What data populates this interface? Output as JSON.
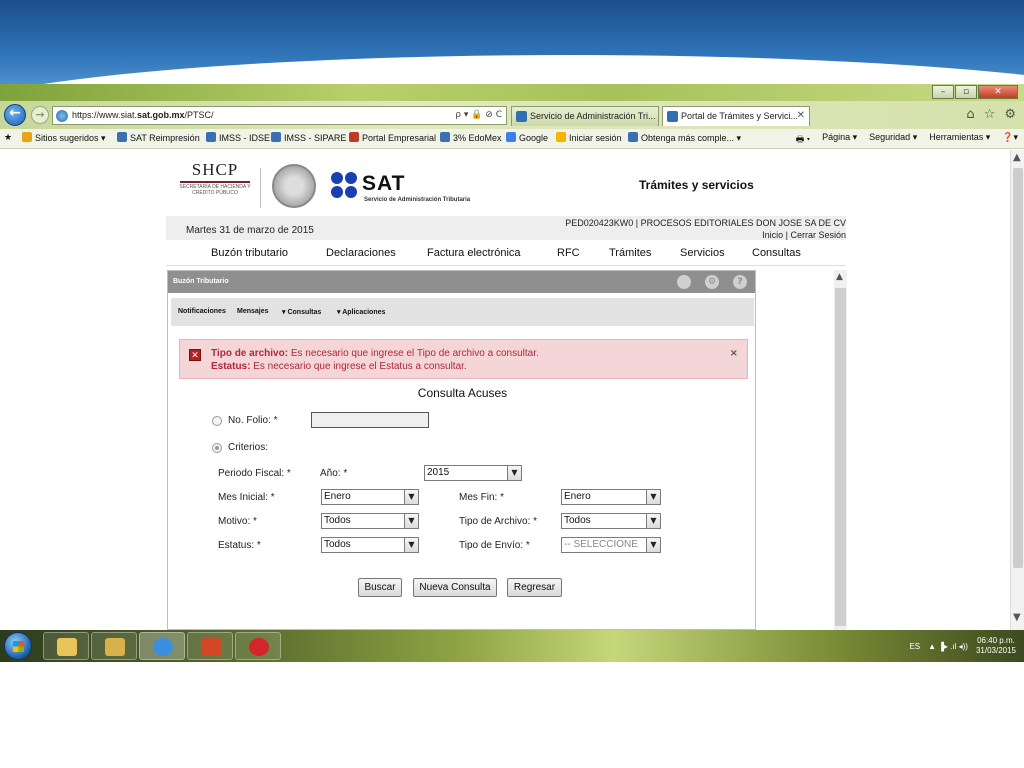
{
  "browser": {
    "url_prefix": "https://www.siat.",
    "url_bold": "sat.gob.mx",
    "url_suffix": "/PTSC/",
    "url_controls": "ρ ▾ 🔒 ⊘ C",
    "tabs": [
      {
        "label": "Servicio de Administración Tri..."
      },
      {
        "label": "Portal de Trámites y Servici...",
        "close": "✕"
      }
    ],
    "favorites": [
      {
        "label": "Sitios sugeridos ▾",
        "color": "#e8a317"
      },
      {
        "label": "SAT Reimpresión",
        "color": "#3a6fb0"
      },
      {
        "label": "IMSS - IDSE",
        "color": "#3a6fb0"
      },
      {
        "label": "IMSS - SIPARE",
        "color": "#3a6fb0"
      },
      {
        "label": "Portal Empresarial",
        "color": "#c0392b"
      },
      {
        "label": "3% EdoMex",
        "color": "#3a6fb0"
      },
      {
        "label": "Google",
        "color": "#3f7ee8"
      },
      {
        "label": "Iniciar sesión",
        "color": "#f4b400"
      },
      {
        "label": "Obtenga más comple... ▾",
        "color": "#3a6fb0"
      }
    ],
    "favorites_right": [
      "Página ▾",
      "Seguridad ▾",
      "Herramientas ▾",
      "❓▾"
    ]
  },
  "header": {
    "shcp_big": "SHCP",
    "shcp_small": "SECRETARÍA DE HACIENDA Y CRÉDITO PÚBLICO",
    "sat_word": "SAT",
    "sat_sub": "Servicio de Administración Tributaria",
    "section_title": "Trámites y servicios"
  },
  "userbar": {
    "date": "Martes 31 de marzo de 2015",
    "rfc": "PED020423KW0 | PROCESOS EDITORIALES DON JOSE SA DE CV",
    "link_inicio": "Inicio",
    "link_sep": " | ",
    "link_cerrar": "Cerrar Sesión"
  },
  "mainnav": [
    "Buzón tributario",
    "Declaraciones",
    "Factura electrónica",
    "RFC",
    "Trámites",
    "Servicios",
    "Consultas"
  ],
  "panel": {
    "title": "Buzón Tributario",
    "menu": [
      "Notificaciones",
      "Mensajes",
      "▾ Consultas",
      "▾ Aplicaciones"
    ],
    "alert": {
      "l1_bold": "Tipo de archivo:",
      "l1_text": " Es necesario que ingrese el Tipo de archivo a consultar.",
      "l2_bold": "Estatus:",
      "l2_text": " Es necesario que ingrese el Estatus a consultar.",
      "dismiss": "×"
    },
    "form_title": "Consulta Acuses",
    "no_folio_label": "No. Folio: *",
    "criterios_label": "Criterios:",
    "periodo_label": "Periodo Fiscal: *",
    "anio_label": "Año: *",
    "anio_value": "2015",
    "mes_inicial_label": "Mes Inicial: *",
    "mes_inicial_value": "Enero",
    "mes_fin_label": "Mes Fin: *",
    "mes_fin_value": "Enero",
    "motivo_label": "Motivo: *",
    "motivo_value": "Todos",
    "tipo_archivo_label": "Tipo de Archivo: *",
    "tipo_archivo_value": "Todos",
    "estatus_label": "Estatus: *",
    "estatus_value": "Todos",
    "tipo_envio_label": "Tipo de Envío: *",
    "tipo_envio_value": "-- SELECCIONE",
    "btn_buscar": "Buscar",
    "btn_nueva": "Nueva Consulta",
    "btn_regresar": "Regresar"
  },
  "taskbar": {
    "lang": "ES",
    "tray_icons": "▲ ▐▸ .ıl ◂))",
    "time": "06:40 p.m.",
    "date": "31/03/2015"
  }
}
